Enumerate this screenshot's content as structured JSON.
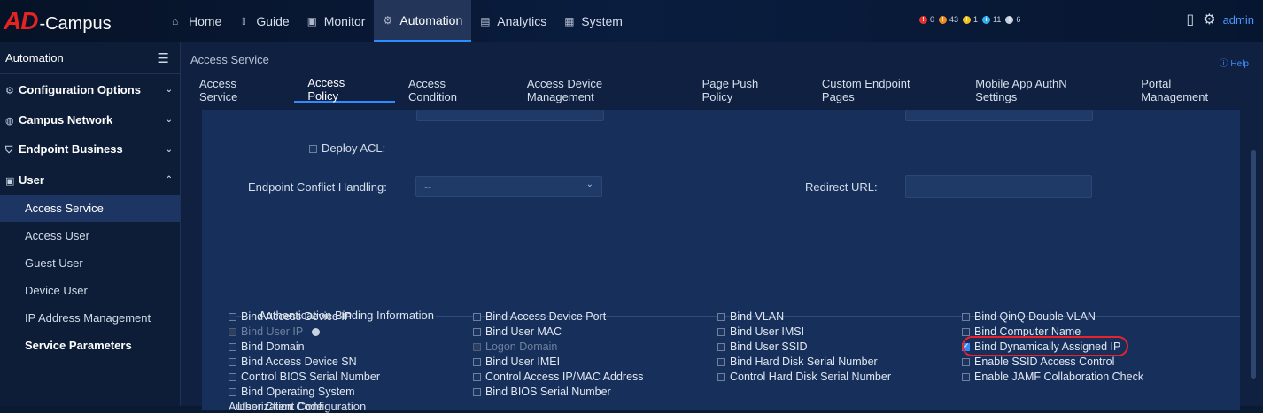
{
  "app": {
    "logo_ad": "AD",
    "logo_campus": "-Campus"
  },
  "top_nav": [
    {
      "label": "Home",
      "icon": "home-icon",
      "glyph": "⌂"
    },
    {
      "label": "Guide",
      "icon": "signpost-icon",
      "glyph": "⇧"
    },
    {
      "label": "Monitor",
      "icon": "monitor-icon",
      "glyph": "▣"
    },
    {
      "label": "Automation",
      "icon": "automation-icon",
      "glyph": "⚙"
    },
    {
      "label": "Analytics",
      "icon": "analytics-icon",
      "glyph": "▤"
    },
    {
      "label": "System",
      "icon": "system-icon",
      "glyph": "▦"
    }
  ],
  "alerts": [
    {
      "count": "0",
      "color": "#e5322d",
      "mark": "!"
    },
    {
      "count": "43",
      "color": "#f08a1c",
      "mark": "!"
    },
    {
      "count": "1",
      "color": "#f2c11a",
      "mark": "!"
    },
    {
      "count": "11",
      "color": "#2fb1f0",
      "mark": "i"
    },
    {
      "count": "6",
      "color": "#c8d0dc",
      "mark": "!"
    }
  ],
  "user": {
    "name": "admin"
  },
  "sidebar": {
    "title": "Automation",
    "groups": [
      {
        "label": "Configuration Options",
        "icon": "gear-icon",
        "glyph": "⚙",
        "chevron": "⌄"
      },
      {
        "label": "Campus Network",
        "icon": "globe-icon",
        "glyph": "◍",
        "chevron": "⌄"
      },
      {
        "label": "Endpoint Business",
        "icon": "shield-icon",
        "glyph": "⛉",
        "chevron": "⌄"
      },
      {
        "label": "User",
        "icon": "user-icon",
        "glyph": "▣",
        "chevron": "⌃"
      }
    ],
    "user_items": [
      "Access Service",
      "Access User",
      "Guest User",
      "Device User",
      "IP Address Management",
      "Service Parameters"
    ]
  },
  "main": {
    "breadcrumb": "Access Service",
    "help": "Help",
    "tabs": [
      "Access Service",
      "Access Policy",
      "Access Condition",
      "Access Device Management",
      "Page Push Policy",
      "Custom Endpoint Pages",
      "Mobile App AuthN Settings",
      "Portal Management"
    ],
    "active_tab": "Access Policy",
    "form": {
      "deploy_acl_label": "Deploy ACL:",
      "endpoint_conflict_label": "Endpoint Conflict Handling:",
      "endpoint_conflict_value": "--",
      "redirect_url_label": "Redirect URL:",
      "redirect_url_value": ""
    },
    "binding_section_title": "Authentication Binding Information",
    "binding_col1": [
      "Bind Access Device IP",
      "Bind User IP",
      "Bind Domain",
      "Bind Access Device SN",
      "Control BIOS Serial Number",
      "Bind Operating System",
      "Authorization Code"
    ],
    "binding_col2": [
      "Bind Access Device Port",
      "Bind User MAC",
      "Logon Domain",
      "Bind User IMEI",
      "Control Access IP/MAC Address",
      "Bind BIOS Serial Number"
    ],
    "binding_col3": [
      "Bind VLAN",
      "Bind User IMSI",
      "Bind User SSID",
      "Bind Hard Disk Serial Number",
      "Control Hard Disk Serial Number"
    ],
    "binding_col4": [
      "Bind QinQ Double VLAN",
      "Bind Computer Name",
      "Bind Dynamically Assigned IP",
      "Enable SSID Access Control",
      "Enable JAMF Collaboration Check"
    ],
    "next_section_title": "User Client Configuration"
  }
}
